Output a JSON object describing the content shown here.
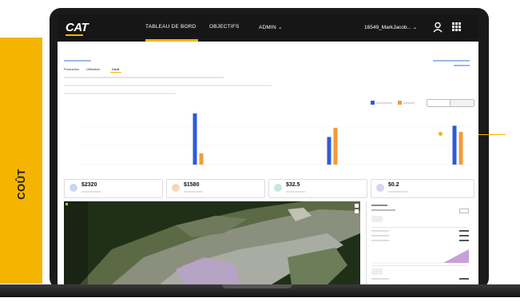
{
  "side_tab": {
    "label": "COÛT"
  },
  "navbar": {
    "logo": "CAT",
    "tabs": [
      "TABLEAU DE BORD",
      "OBJECTIFS",
      "ADMIN ⌄"
    ],
    "user": "16549_MarkJacob... ⌄"
  },
  "dashboard": {
    "tabs": [
      "Production",
      "Utilisation",
      "Coût"
    ],
    "active_tab": 2,
    "cards": [
      {
        "value": "$2320",
        "color": "#c9d6f2"
      },
      {
        "value": "$1580",
        "color": "#f8d7b8"
      },
      {
        "value": "$32.5",
        "color": "#c9e8d6"
      },
      {
        "value": "$0.2",
        "color": "#d9d4f0"
      }
    ]
  },
  "chart_data": {
    "type": "bar",
    "categories": [
      "",
      "",
      ""
    ],
    "series": [
      {
        "color": "#2e5bd8",
        "values": [
          1000,
          540,
          760
        ]
      },
      {
        "color": "#f39a3b",
        "values": [
          220,
          720,
          640
        ]
      }
    ],
    "ylim": [
      0,
      1000
    ]
  },
  "colors": {
    "accent": "#f5b400",
    "nav_bg": "#161616",
    "link": "#1d6fd8"
  }
}
